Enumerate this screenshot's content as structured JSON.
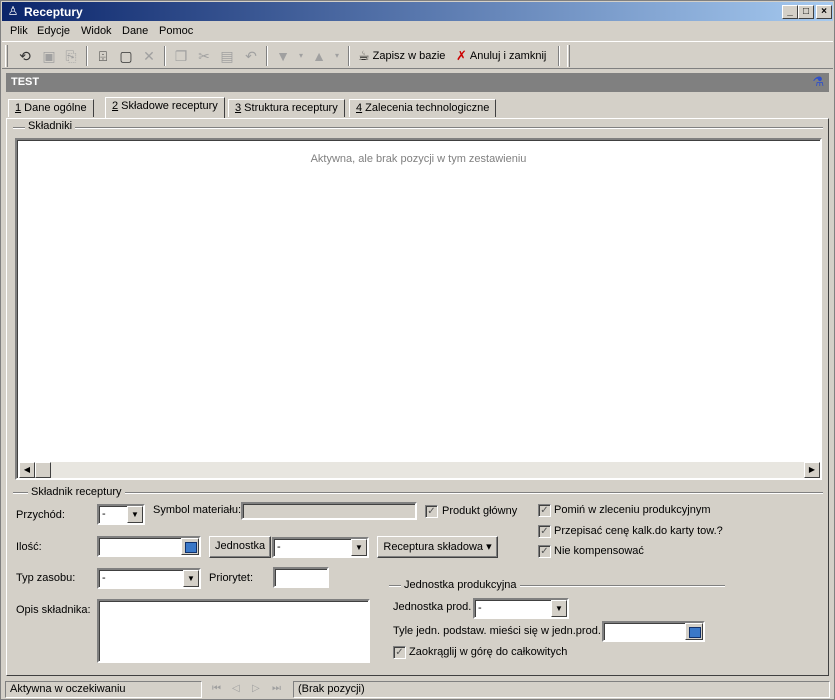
{
  "window": {
    "title": "Receptury"
  },
  "menu": [
    "Plik",
    "Edycje",
    "Widok",
    "Dane",
    "Pomoc"
  ],
  "toolbar": {
    "save_label": "Zapisz w bazie",
    "cancel_label": "Anuluj i zamknij"
  },
  "header": {
    "title": "TEST"
  },
  "tabs": [
    {
      "key": "1",
      "label": " Dane ogólne"
    },
    {
      "key": "2",
      "label": " Składowe receptury"
    },
    {
      "key": "3",
      "label": " Struktura receptury"
    },
    {
      "key": "4",
      "label": " Zalecenia technologiczne"
    }
  ],
  "skladniki": {
    "group_label": "Składniki",
    "empty_text": "Aktywna, ale brak pozycji w tym zestawieniu"
  },
  "form": {
    "group_label": "Składnik receptury",
    "przychod_label": "Przychód:",
    "przychod_value": "-",
    "symbol_label": "Symbol materiału:",
    "symbol_value": "",
    "produkt_glowny_label": "Produkt główny",
    "ilosc_label": "Ilość:",
    "ilosc_value": "",
    "jednostka_button": "Jednostka",
    "jednostka_value": "-",
    "receptura_button": "Receptura składowa ▾",
    "typ_zasobu_label": "Typ zasobu:",
    "typ_zasobu_value": "-",
    "priorytet_label": "Priorytet:",
    "priorytet_value": "",
    "opis_label": "Opis składnika:",
    "pomin_label": "Pomiń w zleceniu produkcyjnym",
    "przepisac_label": "Przepisać cenę kalk.do karty tow.?",
    "nie_kompensowac_label": "Nie kompensować",
    "jedn_group_label": "Jednostka produkcyjna",
    "jedn_prod_label": "Jednostka prod.",
    "jedn_prod_value": "-",
    "tyle_label": "Tyle jedn. podstaw. mieści się w jedn.prod.",
    "tyle_value": "",
    "zaokraglij_label": "Zaokrąglij w górę do całkowitych"
  },
  "status": {
    "state": "Aktywna w oczekiwaniu",
    "positions": "(Brak pozycji)"
  }
}
